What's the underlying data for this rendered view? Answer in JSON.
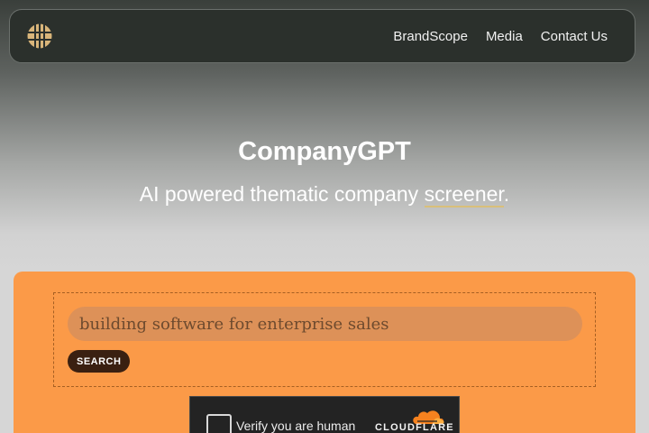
{
  "nav": {
    "logo_icon": "globe-icon",
    "links": [
      "BrandScope",
      "Media",
      "Contact Us"
    ]
  },
  "hero": {
    "title": "CompanyGPT",
    "subtitle_prefix": "AI powered thematic company ",
    "subtitle_highlight": "screener",
    "subtitle_suffix": "."
  },
  "search": {
    "input_value": "",
    "placeholder": "building software for enterprise sales",
    "button_label": "SEARCH"
  },
  "captcha": {
    "label": "Verify you are human",
    "brand": "CLOUDFLARE",
    "brand_icon": "cloud-icon"
  },
  "colors": {
    "card": "#fb9a48",
    "nav_bg": "#2b302c",
    "button": "#3a2011",
    "accent_underline": "#d9bf7a",
    "cloudflare_orange": "#f6821f"
  }
}
